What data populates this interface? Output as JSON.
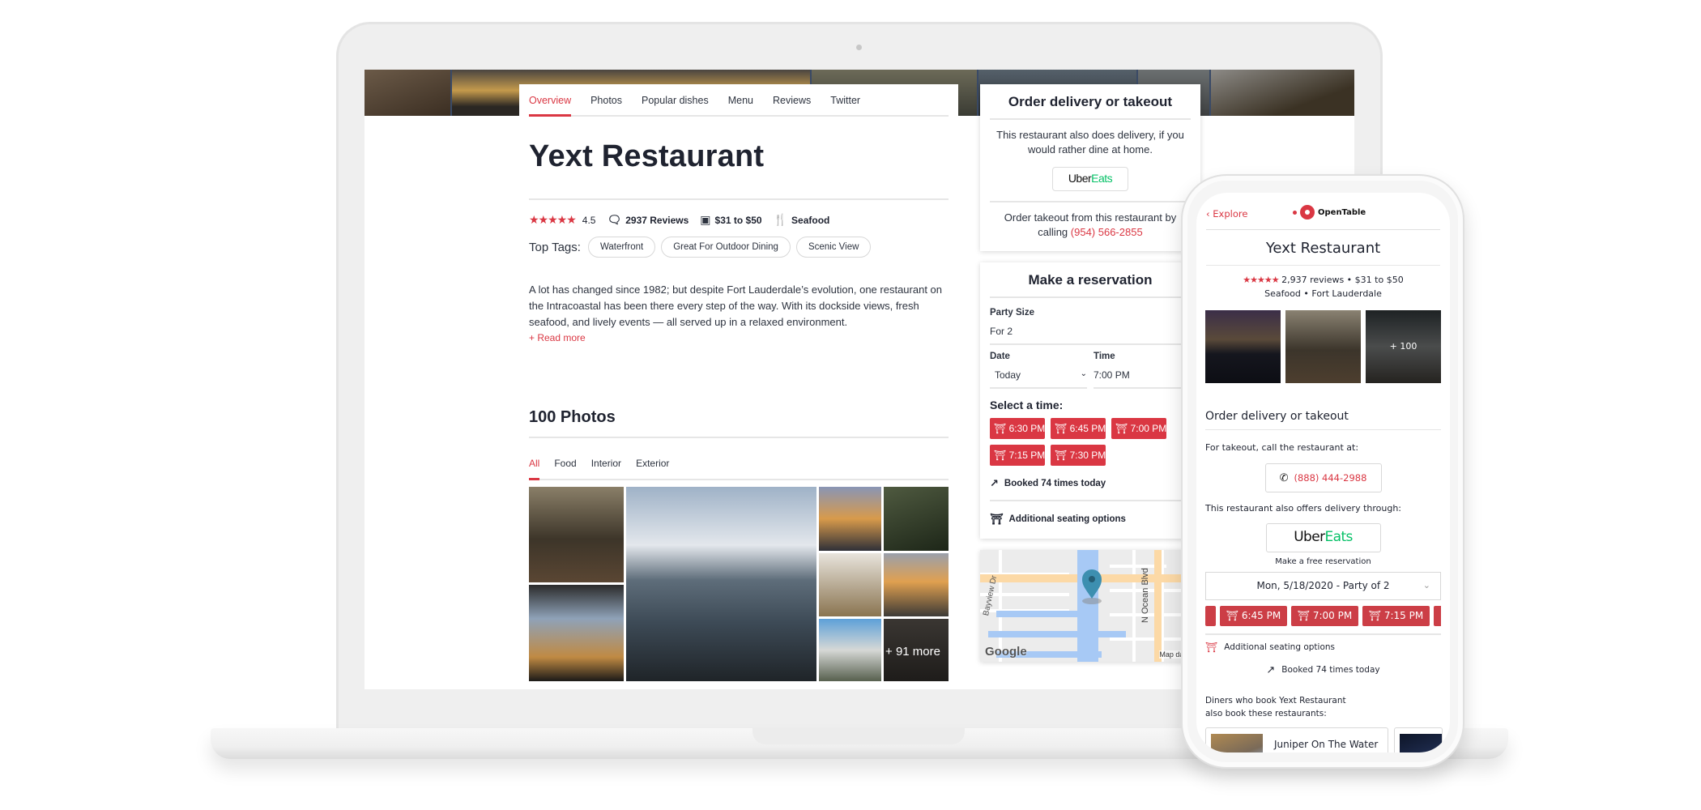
{
  "desktop": {
    "nav_tabs": [
      {
        "label": "Overview",
        "active": true
      },
      {
        "label": "Photos",
        "active": false
      },
      {
        "label": "Popular dishes",
        "active": false
      },
      {
        "label": "Menu",
        "active": false
      },
      {
        "label": "Reviews",
        "active": false
      },
      {
        "label": "Twitter",
        "active": false
      }
    ],
    "restaurant": {
      "name": "Yext Restaurant",
      "rating_stars": "★★★★★",
      "rating": "4.5",
      "reviews": "2937 Reviews",
      "price": "$31 to $50",
      "cuisine": "Seafood"
    },
    "tags": {
      "label": "Top Tags:",
      "items": [
        "Waterfront",
        "Great For Outdoor Dining",
        "Scenic View"
      ]
    },
    "description": "A lot has changed since 1982; but despite Fort Lauderdale’s evolution, one restaurant on the Intracoastal has been there every step of the way. With its dockside views, fresh seafood, and lively events — all served up in a relaxed environment.",
    "read_more": "+ Read more",
    "photos": {
      "title": "100 Photos",
      "tabs": [
        {
          "label": "All",
          "active": true
        },
        {
          "label": "Food",
          "active": false
        },
        {
          "label": "Interior",
          "active": false
        },
        {
          "label": "Exterior",
          "active": false
        }
      ],
      "more_label": "+ 91 more"
    },
    "delivery_card": {
      "title": "Order delivery or takeout",
      "text": "This restaurant also does delivery, if you would rather dine at home.",
      "uber_part1": "Uber",
      "uber_part2": "Eats",
      "takeout_text": "Order takeout from this restaurant by calling",
      "phone": "(954) 566-2855"
    },
    "reservation_card": {
      "title": "Make a reservation",
      "party_size_label": "Party Size",
      "party_size_value": "For 2",
      "date_label": "Date",
      "date_value": "Today",
      "time_label": "Time",
      "time_value": "7:00 PM",
      "select_time": "Select a time:",
      "slots": [
        "6:30 PM",
        "6:45 PM",
        "7:00 PM",
        "7:15 PM",
        "7:30 PM"
      ],
      "booked": "Booked 74 times today",
      "additional": "Additional seating options"
    },
    "map": {
      "street1": "Bayview Dr",
      "street2": "N Ocean Blvd",
      "logo": "Google",
      "attribution": "Map data ©"
    }
  },
  "mobile": {
    "back": "Explore",
    "logo": "OpenTable",
    "title": "Yext Restaurant",
    "rating_stars": "★★★★★",
    "meta_line1": "2,937 reviews • $31 to $50",
    "meta_line2": "Seafood • Fort Lauderdale",
    "photo_more": "+ 100",
    "order_title": "Order delivery or takeout",
    "takeout_text": "For takeout, call the restaurant at:",
    "phone": "(888) 444-2988",
    "delivery_text": "This restaurant also offers delivery through:",
    "uber_part1": "Uber",
    "uber_part2": "Eats",
    "free_reservation": "Make a free reservation",
    "date_party": "Mon, 5/18/2020 - Party of 2",
    "slots": [
      "6:45 PM",
      "7:00 PM",
      "7:15 PM"
    ],
    "additional": "Additional seating options",
    "booked": "Booked 74 times today",
    "diners_text": "Diners who book Yext Restaurant also book these restaurants:",
    "rec_name": "Juniper On The Water"
  },
  "colors": {
    "accent": "#da3743",
    "uber_green": "#06c167",
    "map_pin": "#3d8fb0"
  }
}
